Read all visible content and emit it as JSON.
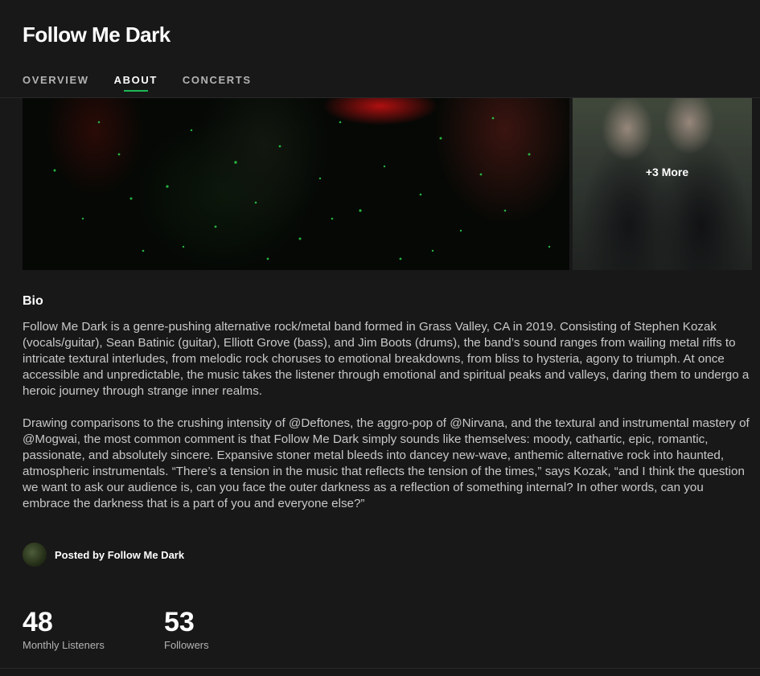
{
  "artist": {
    "name": "Follow Me Dark"
  },
  "tabs": [
    {
      "label": "OVERVIEW",
      "active": false
    },
    {
      "label": "ABOUT",
      "active": true
    },
    {
      "label": "CONCERTS",
      "active": false
    }
  ],
  "gallery": {
    "more_label": "+3 More"
  },
  "bio": {
    "title": "Bio",
    "paragraphs": [
      "Follow Me Dark is a genre-pushing alternative rock/metal band formed in Grass Valley, CA in 2019. Consisting of Stephen Kozak (vocals/guitar), Sean Batinic (guitar), Elliott Grove (bass), and Jim Boots (drums), the band’s sound ranges from wailing metal riffs to intricate textural interludes, from melodic rock choruses to emotional breakdowns, from bliss to hysteria, agony to triumph. At once accessible and unpredictable, the music takes the listener through emotional and spiritual peaks and valleys, daring them to undergo a heroic journey through strange inner realms.",
      "Drawing comparisons to the crushing intensity of @Deftones, the aggro-pop of @Nirvana, and the textural and instrumental mastery of @Mogwai, the most common comment is that Follow Me Dark simply sounds like themselves: moody, cathartic, epic, romantic, passionate, and absolutely sincere.  Expansive stoner metal bleeds into dancey new-wave, anthemic alternative rock into haunted, atmospheric instrumentals. “There’s a tension in the music that reflects the tension of the times,” says Kozak, “and I think the question we want to ask our audience is, can you face the outer darkness as a reflection of something internal? In other words, can you embrace the darkness that is a part of you and everyone else?”"
    ]
  },
  "posted_by": {
    "label": "Posted by Follow Me Dark"
  },
  "stats": {
    "monthly_listeners": {
      "value": "48",
      "label": "Monthly Listeners"
    },
    "followers": {
      "value": "53",
      "label": "Followers"
    }
  },
  "colors": {
    "background": "#181818",
    "accent": "#1db954",
    "text_secondary": "#b3b3b3"
  }
}
